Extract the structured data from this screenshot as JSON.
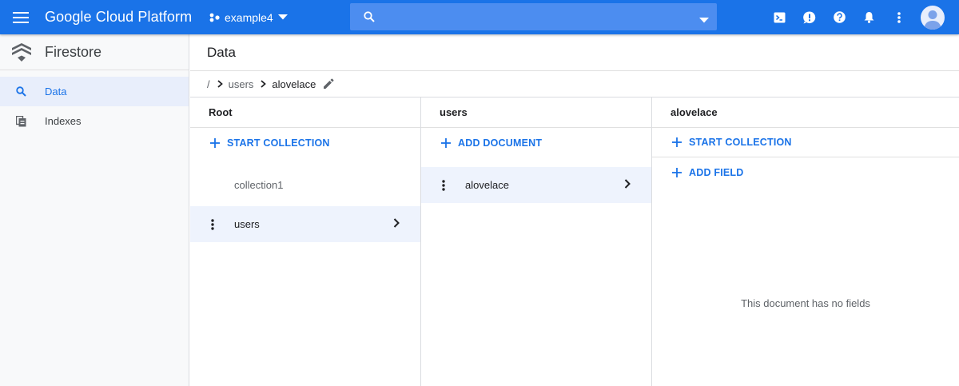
{
  "topbar": {
    "brand": "Google Cloud Platform",
    "project_name": "example4",
    "search_placeholder": "",
    "icons": [
      "menu-icon",
      "project-dots-icon",
      "dropdown-arrow-icon",
      "search-icon",
      "cloud-shell-icon",
      "notification-alert-icon",
      "help-icon",
      "bell-icon",
      "more-vert-icon",
      "account-avatar"
    ]
  },
  "sidebar": {
    "product": "Firestore",
    "items": [
      {
        "label": "Data",
        "icon": "search-icon",
        "active": true
      },
      {
        "label": "Indexes",
        "icon": "indexes-icon",
        "active": false
      }
    ]
  },
  "main": {
    "title": "Data",
    "breadcrumb": {
      "root": "/",
      "collection": "users",
      "document": "alovelace"
    },
    "columns": {
      "root": {
        "header": "Root",
        "action": "START COLLECTION",
        "items": [
          "collection1",
          "users"
        ]
      },
      "collection": {
        "header": "users",
        "action": "ADD DOCUMENT",
        "items": [
          "alovelace"
        ]
      },
      "document": {
        "header": "alovelace",
        "action_collection": "START COLLECTION",
        "action_field": "ADD FIELD",
        "empty_message": "This document has no fields"
      }
    }
  },
  "colors": {
    "accent": "#1a73e8",
    "selected_row": "#eef3fd",
    "sidebar_bg": "#f8f9fa"
  }
}
